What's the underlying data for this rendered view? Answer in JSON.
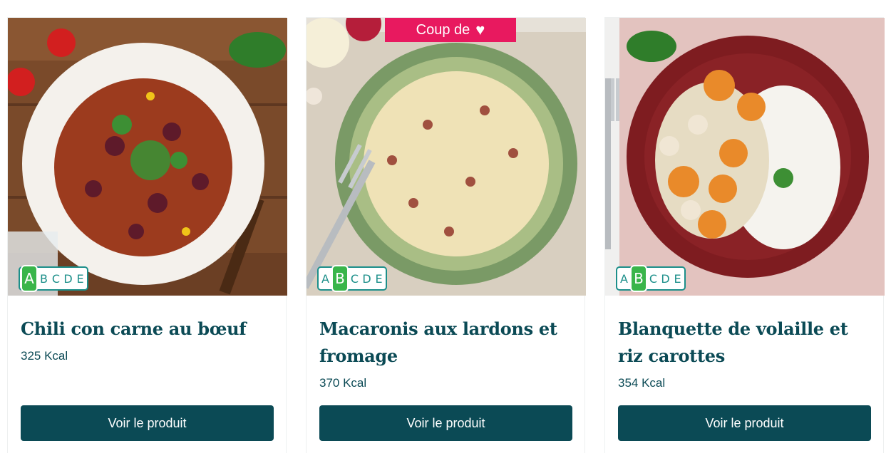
{
  "products": [
    {
      "name": "Chili con carne au bœuf",
      "kcal": "325 Kcal",
      "button_label": "Voir le produit",
      "nutriscore": {
        "letters": [
          "A",
          "B",
          "C",
          "D",
          "E"
        ],
        "grade": "A"
      },
      "badge": null
    },
    {
      "name": "Macaronis aux lardons et fromage",
      "kcal": "370 Kcal",
      "button_label": "Voir le produit",
      "nutriscore": {
        "letters": [
          "A",
          "B",
          "C",
          "D",
          "E"
        ],
        "grade": "B"
      },
      "badge": {
        "text": "Coup de",
        "icon": "heart-icon",
        "color": "#e8195f"
      }
    },
    {
      "name": "Blanquette de volaille et riz carottes",
      "kcal": "354 Kcal",
      "button_label": "Voir le produit",
      "nutriscore": {
        "letters": [
          "A",
          "B",
          "C",
          "D",
          "E"
        ],
        "grade": "B"
      },
      "badge": null
    }
  ],
  "colors": {
    "primary": "#0b4a55",
    "badge": "#e8195f",
    "nutri_border": "#1c8f8a",
    "nutri_active": "#39b54a"
  }
}
